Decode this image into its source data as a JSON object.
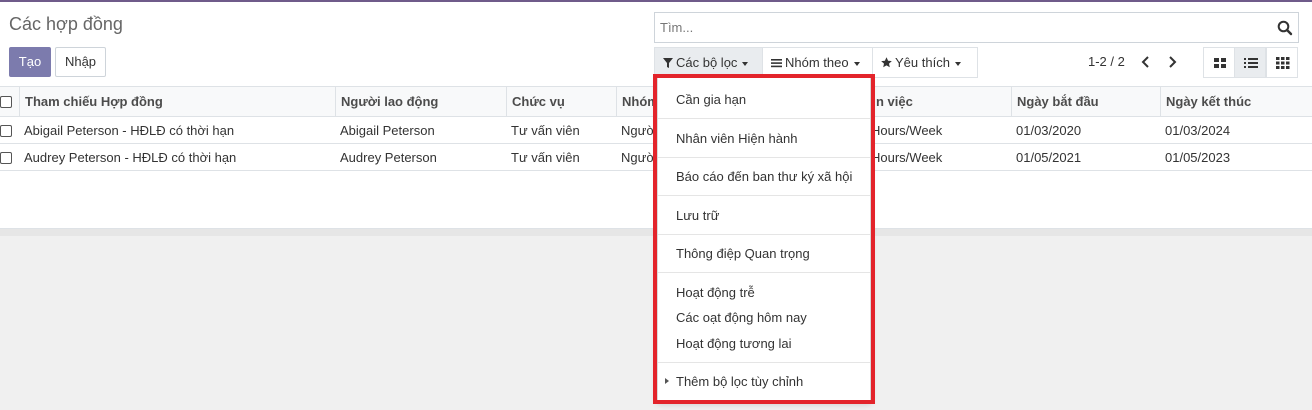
{
  "breadcrumb": "Các hợp đồng",
  "buttons": {
    "create": "Tạo",
    "import": "Nhập"
  },
  "search": {
    "placeholder": "Tìm..."
  },
  "filters": {
    "filters_label": "Các bộ lọc",
    "group_by_label": "Nhóm theo",
    "favorites_label": "Yêu thích"
  },
  "pager": {
    "value": "1-2 / 2"
  },
  "columns": {
    "reference": "Tham chiếu Hợp đồng",
    "employee": "Người lao động",
    "job": "Chức vụ",
    "group": "Nhóm",
    "work": "n việc",
    "start": "Ngày bắt đầu",
    "end": "Ngày kết thúc"
  },
  "rows": [
    {
      "reference": "Abigail Peterson - HĐLĐ có thời hạn",
      "employee": "Abigail Peterson",
      "job": "Tư vấn viên",
      "group": "Người",
      "work": "Hours/Week",
      "start": "01/03/2020",
      "end": "01/03/2024"
    },
    {
      "reference": "Audrey Peterson - HĐLĐ có thời hạn",
      "employee": "Audrey Peterson",
      "job": "Tư vấn viên",
      "group": "Người",
      "work": "Hours/Week",
      "start": "01/05/2021",
      "end": "01/05/2023"
    }
  ],
  "dropdown": {
    "items": [
      "Cần gia hạn",
      "Nhân viên Hiện hành",
      "Báo cáo đến ban thư ký xã hội",
      "Lưu trữ",
      "Thông điệp Quan trọng",
      "Hoạt động trễ",
      "Các oạt động hôm nay",
      "Hoạt động tương lai",
      "Thêm bộ lọc tùy chỉnh"
    ]
  },
  "colors": {
    "brand": "#7c7bad",
    "highlight": "#e3242b"
  },
  "icons": [
    "search-icon",
    "filter-icon",
    "bars-icon",
    "star-icon",
    "chevron-left-icon",
    "chevron-right-icon",
    "kanban-view-icon",
    "list-view-icon",
    "grid-view-icon",
    "caret-right-icon"
  ]
}
